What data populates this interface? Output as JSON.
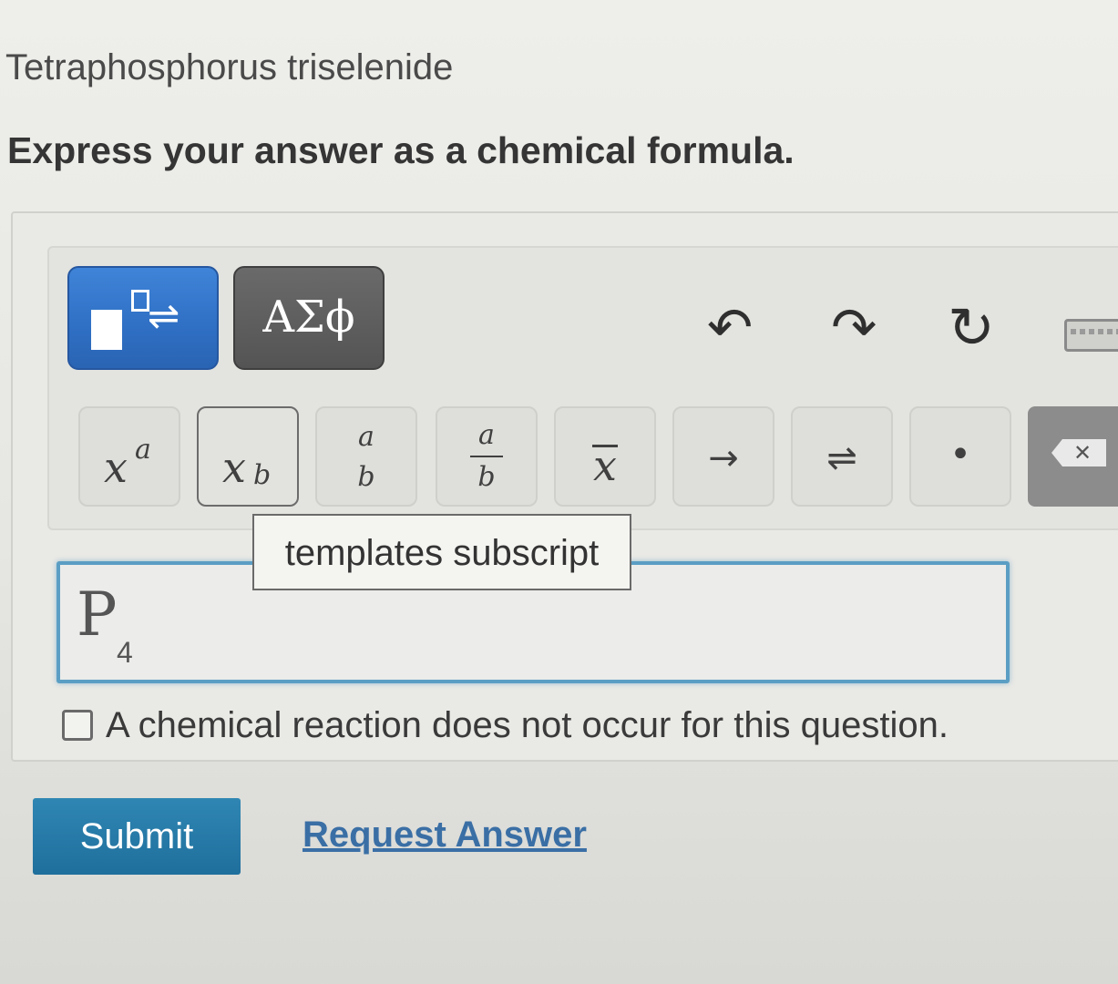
{
  "question": {
    "title": "Tetraphosphorus triselenide",
    "instruction": "Express your answer as a chemical formula."
  },
  "toolbar": {
    "mode_templates_icon": "templates-arrow-icon",
    "mode_symbols_label": "ΑΣϕ",
    "undo_icon": "↶",
    "redo_icon": "↷",
    "reset_icon": "↻",
    "keyboard_icon": "keyboard-icon"
  },
  "template_buttons": {
    "superscript": {
      "base": "x",
      "script": "a"
    },
    "subscript": {
      "base": "x",
      "script": "b"
    },
    "stack": {
      "top": "a",
      "bottom": "b"
    },
    "fraction": {
      "top": "a",
      "bottom": "b"
    },
    "overline": {
      "base": "x"
    },
    "arrow": "→",
    "equilibrium": "⇌",
    "dot": "•",
    "delete": "✕"
  },
  "tooltip": "templates subscript",
  "answer": {
    "element": "P",
    "subscript": "4"
  },
  "checkbox": {
    "label": "A chemical reaction does not occur for this question.",
    "checked": false
  },
  "actions": {
    "submit_label": "Submit",
    "request_answer_label": "Request Answer"
  },
  "colors": {
    "accent_blue": "#2f6fc4",
    "submit_blue": "#1f6f9c",
    "input_border": "#5b9ec4",
    "link": "#3a6fa5"
  }
}
